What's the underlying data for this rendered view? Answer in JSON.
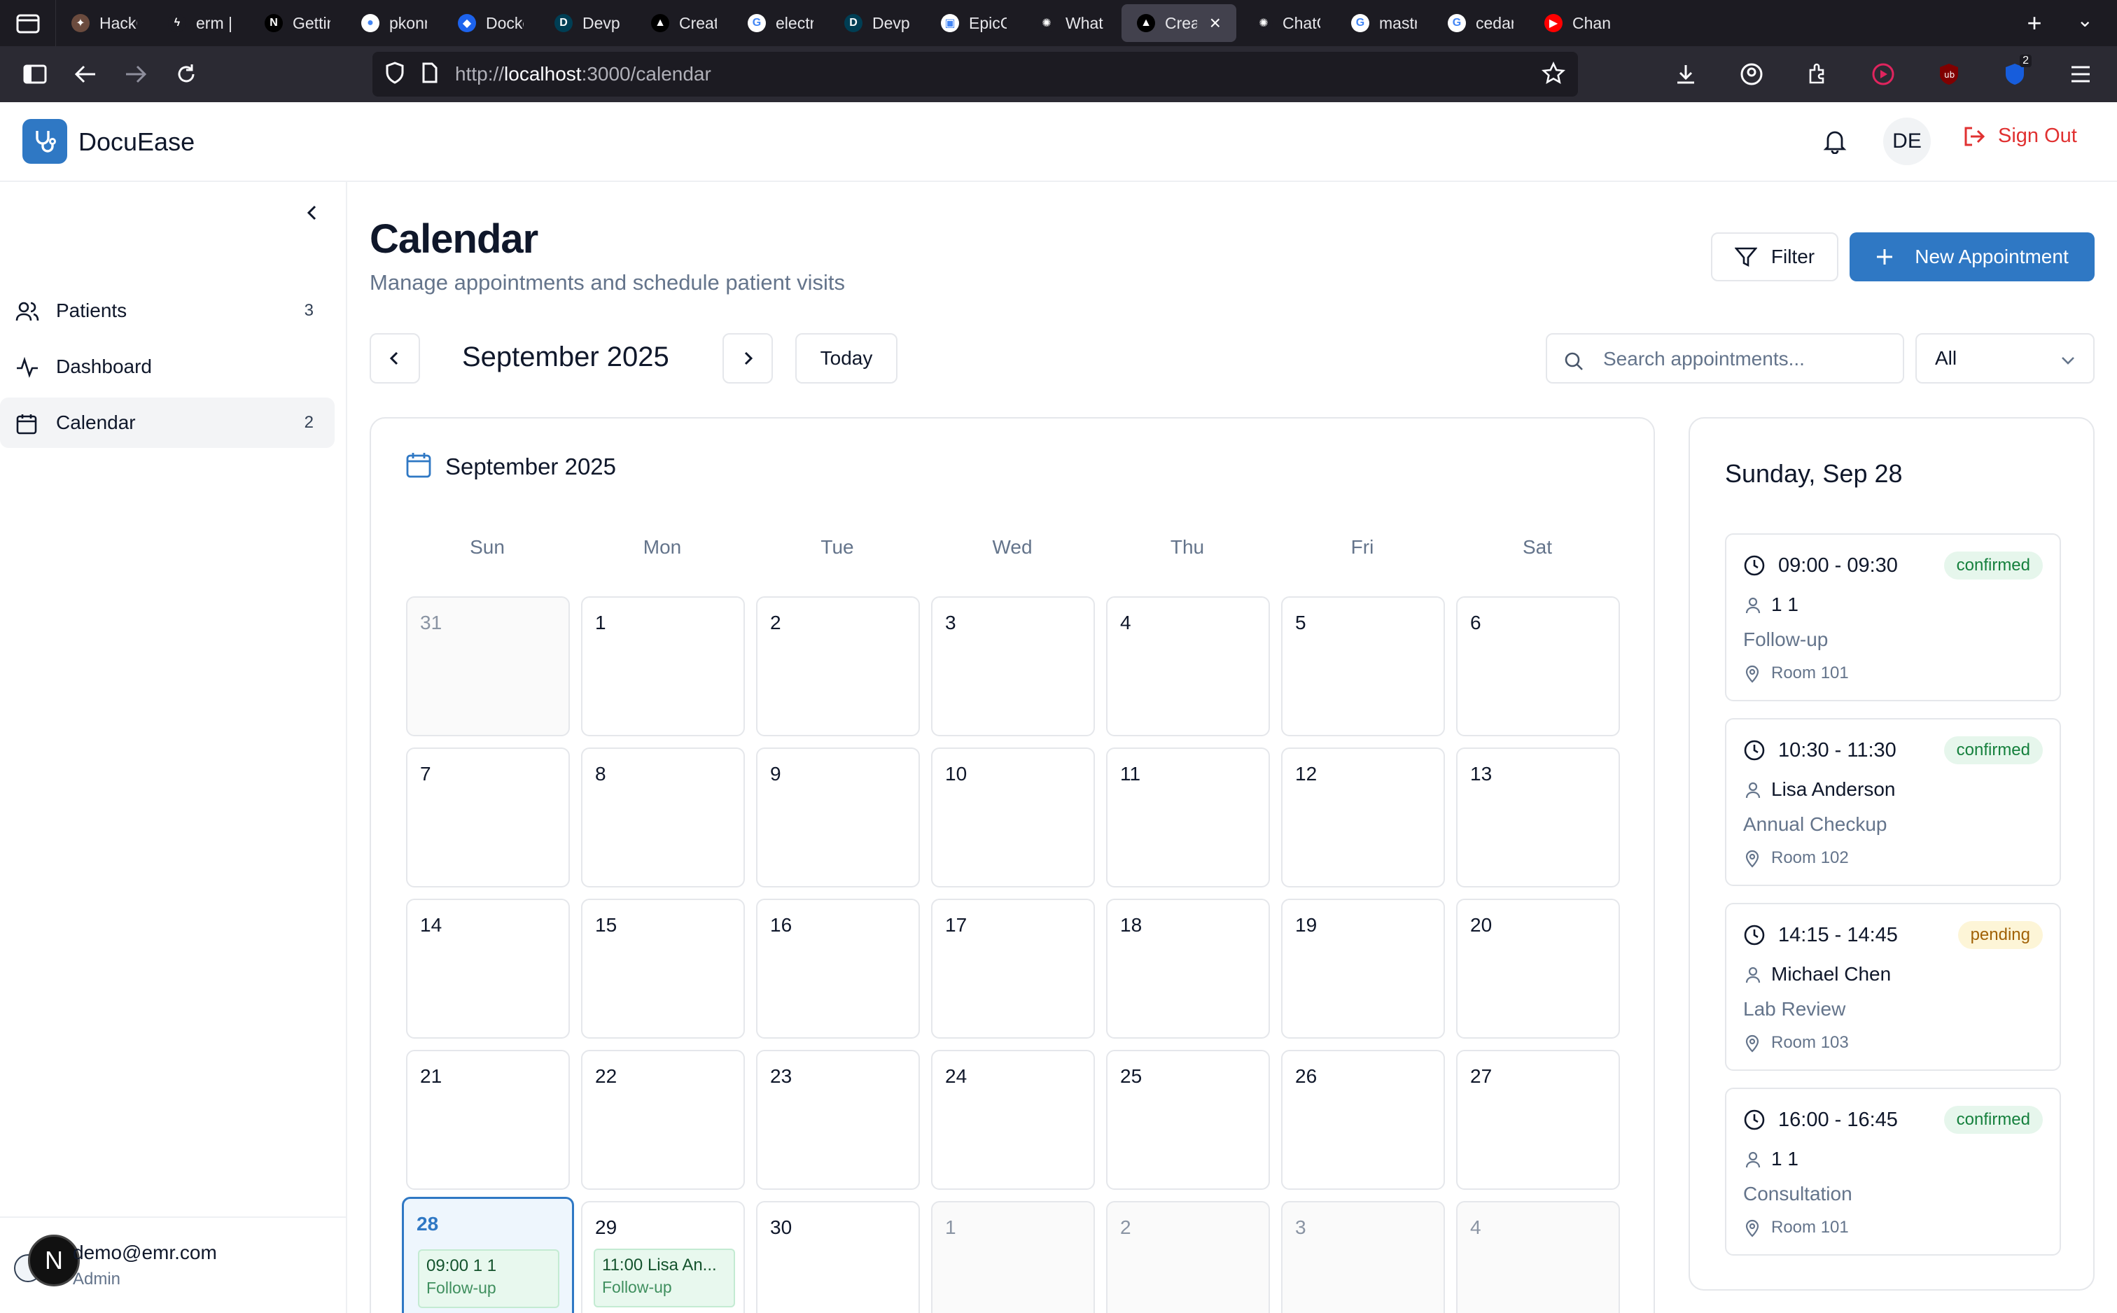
{
  "browser": {
    "tabs": [
      {
        "title": "HackGT",
        "fav_color": "#6b4b3e",
        "fav_glyph": "✦"
      },
      {
        "title": "erm | pk",
        "fav_color": "#1c1b22",
        "fav_glyph": "ϟ"
      },
      {
        "title": "Getting",
        "fav_color": "#000000",
        "fav_glyph": "N"
      },
      {
        "title": "pkonnot",
        "fav_color": "#ffffff",
        "fav_glyph": "●"
      },
      {
        "title": "Docker:",
        "fav_color": "#1d63ed",
        "fav_glyph": "◆"
      },
      {
        "title": "Devpost",
        "fav_color": "#003e54",
        "fav_glyph": "D"
      },
      {
        "title": "Create N",
        "fav_color": "#000000",
        "fav_glyph": "▲"
      },
      {
        "title": "electron",
        "fav_color": "#ffffff",
        "fav_glyph": "G"
      },
      {
        "title": "Devpost",
        "fav_color": "#003e54",
        "fav_glyph": "D"
      },
      {
        "title": "EpicCare",
        "fav_color": "#ffffff",
        "fav_glyph": "▣"
      },
      {
        "title": "What is",
        "fav_color": "#1c1b22",
        "fav_glyph": "✺"
      },
      {
        "title": "Creat",
        "fav_color": "#000000",
        "fav_glyph": "▲",
        "active": true
      },
      {
        "title": "ChatGPT",
        "fav_color": "#1c1b22",
        "fav_glyph": "✺"
      },
      {
        "title": "mastra -",
        "fav_color": "#ffffff",
        "fav_glyph": "G"
      },
      {
        "title": "cedar os",
        "fav_color": "#ffffff",
        "fav_glyph": "G"
      },
      {
        "title": "Channel",
        "fav_color": "#ff0000",
        "fav_glyph": "▶"
      }
    ],
    "url_prefix": "http://",
    "url_host": "localhost",
    "url_path": ":3000/calendar",
    "extension_badge": "2"
  },
  "app": {
    "brand": "DocuEase",
    "user_initials": "DE",
    "sign_out": "Sign Out"
  },
  "sidebar": {
    "items": [
      {
        "label": "Patients",
        "count": "3",
        "icon": "users-icon"
      },
      {
        "label": "Dashboard",
        "count": "",
        "icon": "activity-icon"
      },
      {
        "label": "Calendar",
        "count": "2",
        "icon": "calendar-icon",
        "active": true
      }
    ],
    "user_email": "demo@emr.com",
    "user_role": "Admin",
    "badge": "N"
  },
  "page": {
    "title": "Calendar",
    "subtitle": "Manage appointments and schedule patient visits",
    "filter_label": "Filter",
    "new_label": "New Appointment",
    "month_label": "September 2025",
    "today_label": "Today",
    "search_placeholder": "Search appointments...",
    "select_value": "All"
  },
  "calendar": {
    "title": "September 2025",
    "weekdays": [
      "Sun",
      "Mon",
      "Tue",
      "Wed",
      "Thu",
      "Fri",
      "Sat"
    ],
    "weeks": [
      [
        {
          "n": "31",
          "other": true
        },
        {
          "n": "1"
        },
        {
          "n": "2"
        },
        {
          "n": "3"
        },
        {
          "n": "4"
        },
        {
          "n": "5"
        },
        {
          "n": "6"
        }
      ],
      [
        {
          "n": "7"
        },
        {
          "n": "8"
        },
        {
          "n": "9"
        },
        {
          "n": "10"
        },
        {
          "n": "11"
        },
        {
          "n": "12"
        },
        {
          "n": "13"
        }
      ],
      [
        {
          "n": "14"
        },
        {
          "n": "15"
        },
        {
          "n": "16"
        },
        {
          "n": "17"
        },
        {
          "n": "18"
        },
        {
          "n": "19"
        },
        {
          "n": "20"
        }
      ],
      [
        {
          "n": "21"
        },
        {
          "n": "22"
        },
        {
          "n": "23"
        },
        {
          "n": "24"
        },
        {
          "n": "25"
        },
        {
          "n": "26"
        },
        {
          "n": "27"
        }
      ],
      [
        {
          "n": "28",
          "today": true,
          "events": [
            {
              "title": "09:00 1 1",
              "sub": "Follow-up"
            }
          ]
        },
        {
          "n": "29",
          "events": [
            {
              "title": "11:00 Lisa An...",
              "sub": "Follow-up"
            }
          ]
        },
        {
          "n": "30"
        },
        {
          "n": "1",
          "other": true
        },
        {
          "n": "2",
          "other": true
        },
        {
          "n": "3",
          "other": true
        },
        {
          "n": "4",
          "other": true
        }
      ]
    ]
  },
  "day_panel": {
    "title": "Sunday, Sep 28",
    "appointments": [
      {
        "time": "09:00 - 09:30",
        "status": "confirmed",
        "name": "1 1",
        "type": "Follow-up",
        "room": "Room 101"
      },
      {
        "time": "10:30 - 11:30",
        "status": "confirmed",
        "name": "Lisa Anderson",
        "type": "Annual Checkup",
        "room": "Room 102"
      },
      {
        "time": "14:15 - 14:45",
        "status": "pending",
        "name": "Michael Chen",
        "type": "Lab Review",
        "room": "Room 103"
      },
      {
        "time": "16:00 - 16:45",
        "status": "confirmed",
        "name": "1 1",
        "type": "Consultation",
        "room": "Room 101"
      }
    ]
  }
}
